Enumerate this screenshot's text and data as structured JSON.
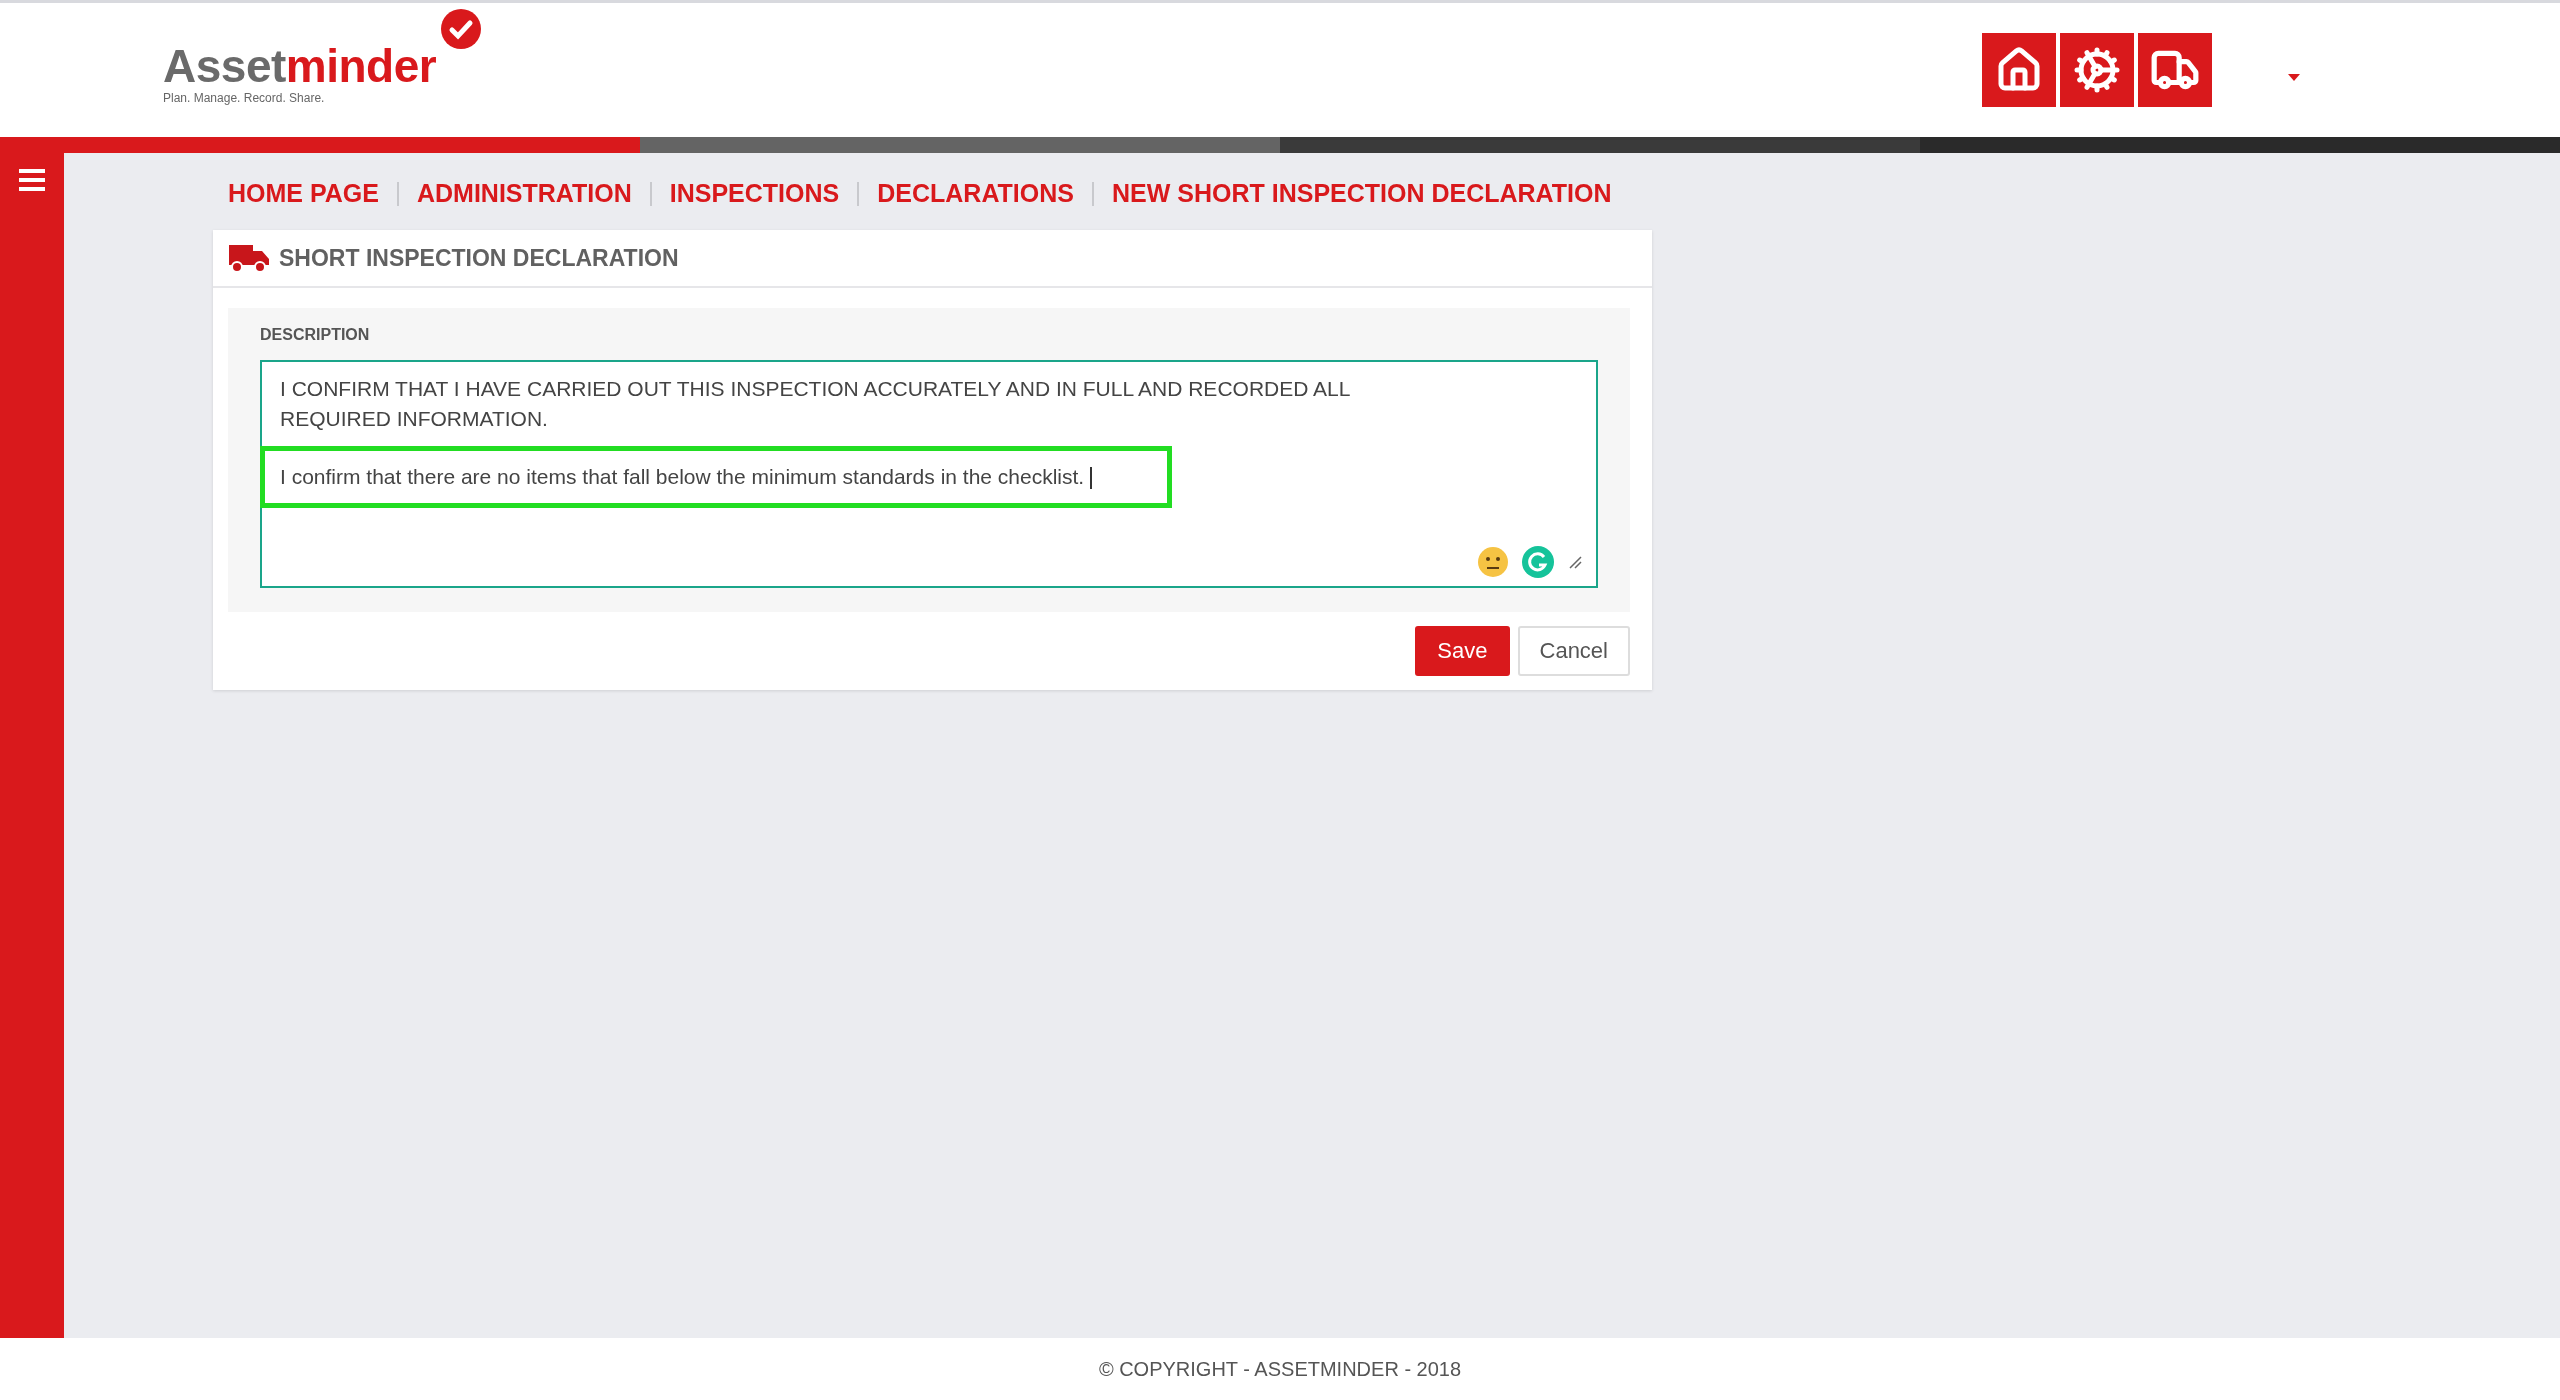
{
  "header": {
    "logo": {
      "prefix": "Asset",
      "suffix": "minder",
      "tagline": "Plan. Manage. Record. Share."
    }
  },
  "breadcrumb": [
    "HOME PAGE",
    "ADMINISTRATION",
    "INSPECTIONS",
    "DECLARATIONS",
    "NEW SHORT INSPECTION DECLARATION"
  ],
  "card": {
    "title": "SHORT INSPECTION DECLARATION",
    "field": {
      "label": "DESCRIPTION",
      "paragraphs": [
        {
          "text": "I CONFIRM THAT I HAVE CARRIED OUT THIS INSPECTION ACCURATELY AND IN FULL AND RECORDED ALL REQUIRED INFORMATION.",
          "highlighted": false
        },
        {
          "text": "I confirm that there are no items that fall below the minimum standards in the checklist.",
          "highlighted": true
        }
      ]
    },
    "buttons": [
      {
        "label": "Save",
        "kind": "primary"
      },
      {
        "label": "Cancel",
        "kind": "default"
      }
    ]
  },
  "footer": "© COPYRIGHT - ASSETMINDER - 2018"
}
